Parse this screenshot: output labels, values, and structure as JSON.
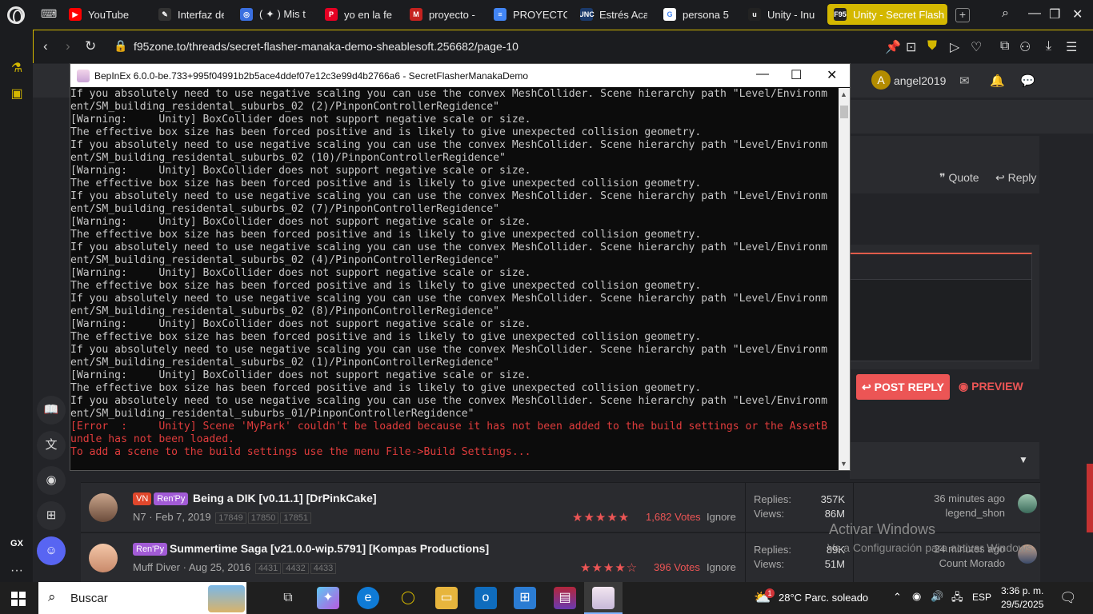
{
  "browser": {
    "tabs": [
      {
        "label": "YouTube",
        "color": "#ff0000",
        "glyph": "▶"
      },
      {
        "label": "Interfaz de",
        "color": "#333333",
        "glyph": "✎"
      },
      {
        "label": "( ✦ ) Mis t",
        "color": "#3a6fe0",
        "glyph": "◎"
      },
      {
        "label": "yo en la fe",
        "color": "#e60023",
        "glyph": "P"
      },
      {
        "label": "proyecto -",
        "color": "#c5221f",
        "glyph": "M"
      },
      {
        "label": "PROYECTO",
        "color": "#4285f4",
        "glyph": "≡"
      },
      {
        "label": "Estrés Aca",
        "color": "#1b3a6b",
        "glyph": "UNC"
      },
      {
        "label": "persona 5",
        "color": "#ffffff",
        "glyph": "G"
      },
      {
        "label": "Unity - Inu",
        "color": "#222222",
        "glyph": "u"
      },
      {
        "label": "Unity - Secret Flash",
        "color": "#222222",
        "glyph": "F95"
      }
    ],
    "tab_add": "+",
    "url": "f95zone.to/threads/secret-flasher-manaka-demo-sheablesoft.256682/page-10"
  },
  "forum": {
    "username": "angel2019",
    "avatar_letter": "A",
    "quote_label": "Quote",
    "reply_label": "Reply",
    "post_reply_label": "POST REPLY",
    "preview_label": "PREVIEW",
    "threads": [
      {
        "badges": [
          {
            "text": "VN",
            "color": "#e0472c"
          },
          {
            "text": "Ren'Py",
            "color": "#a25bd6"
          }
        ],
        "title": "Being a DIK [v0.11.1] [DrPinkCake]",
        "author_date": "N7 · Feb 7, 2019",
        "pages": [
          "17849",
          "17850",
          "17851"
        ],
        "stars": "★★★★★",
        "votes": "1,682 Votes",
        "ignore": "Ignore",
        "replies_label": "Replies:",
        "replies": "357K",
        "views_label": "Views:",
        "views": "86M",
        "last_time": "36 minutes ago",
        "last_user": "legend_shon"
      },
      {
        "badges": [
          {
            "text": "Ren'Py",
            "color": "#a25bd6"
          }
        ],
        "title": "Summertime Saga [v21.0.0-wip.5791] [Kompas Productions]",
        "author_date": "Muff Diver · Aug 25, 2016",
        "pages": [
          "4431",
          "4432",
          "4433"
        ],
        "stars": "★★★★☆",
        "votes": "396 Votes",
        "ignore": "Ignore",
        "replies_label": "Replies:",
        "replies": "89K",
        "views_label": "Views:",
        "views": "51M",
        "last_time": "24 minutes ago",
        "last_user": "Count Morado"
      }
    ],
    "activate_title": "Activar Windows",
    "activate_sub": "Ve a Configuración para activar Windows."
  },
  "console": {
    "title": "BepInEx 6.0.0-be.733+995f04991b2b5ace4ddef07e12c3e99d4b2766a6 - SecretFlasherManakaDemo",
    "lines": [
      {
        "t": "If you absolutely need to use negative scaling you can use the convex MeshCollider. Scene hierarchy path \"Level/Environm",
        "err": false
      },
      {
        "t": "ent/SM_building_residental_suburbs_02 (2)/PinponControllerRegidence\"",
        "err": false
      },
      {
        "t": "[Warning:     Unity] BoxCollider does not support negative scale or size.",
        "err": false
      },
      {
        "t": "The effective box size has been forced positive and is likely to give unexpected collision geometry.",
        "err": false
      },
      {
        "t": "If you absolutely need to use negative scaling you can use the convex MeshCollider. Scene hierarchy path \"Level/Environm",
        "err": false
      },
      {
        "t": "ent/SM_building_residental_suburbs_02 (10)/PinponControllerRegidence\"",
        "err": false
      },
      {
        "t": "[Warning:     Unity] BoxCollider does not support negative scale or size.",
        "err": false
      },
      {
        "t": "The effective box size has been forced positive and is likely to give unexpected collision geometry.",
        "err": false
      },
      {
        "t": "If you absolutely need to use negative scaling you can use the convex MeshCollider. Scene hierarchy path \"Level/Environm",
        "err": false
      },
      {
        "t": "ent/SM_building_residental_suburbs_02 (7)/PinponControllerRegidence\"",
        "err": false
      },
      {
        "t": "[Warning:     Unity] BoxCollider does not support negative scale or size.",
        "err": false
      },
      {
        "t": "The effective box size has been forced positive and is likely to give unexpected collision geometry.",
        "err": false
      },
      {
        "t": "If you absolutely need to use negative scaling you can use the convex MeshCollider. Scene hierarchy path \"Level/Environm",
        "err": false
      },
      {
        "t": "ent/SM_building_residental_suburbs_02 (4)/PinponControllerRegidence\"",
        "err": false
      },
      {
        "t": "[Warning:     Unity] BoxCollider does not support negative scale or size.",
        "err": false
      },
      {
        "t": "The effective box size has been forced positive and is likely to give unexpected collision geometry.",
        "err": false
      },
      {
        "t": "If you absolutely need to use negative scaling you can use the convex MeshCollider. Scene hierarchy path \"Level/Environm",
        "err": false
      },
      {
        "t": "ent/SM_building_residental_suburbs_02 (8)/PinponControllerRegidence\"",
        "err": false
      },
      {
        "t": "[Warning:     Unity] BoxCollider does not support negative scale or size.",
        "err": false
      },
      {
        "t": "The effective box size has been forced positive and is likely to give unexpected collision geometry.",
        "err": false
      },
      {
        "t": "If you absolutely need to use negative scaling you can use the convex MeshCollider. Scene hierarchy path \"Level/Environm",
        "err": false
      },
      {
        "t": "ent/SM_building_residental_suburbs_02 (1)/PinponControllerRegidence\"",
        "err": false
      },
      {
        "t": "[Warning:     Unity] BoxCollider does not support negative scale or size.",
        "err": false
      },
      {
        "t": "The effective box size has been forced positive and is likely to give unexpected collision geometry.",
        "err": false
      },
      {
        "t": "If you absolutely need to use negative scaling you can use the convex MeshCollider. Scene hierarchy path \"Level/Environm",
        "err": false
      },
      {
        "t": "ent/SM_building_residental_suburbs_01/PinponControllerRegidence\"",
        "err": false
      },
      {
        "t": "[Error  :     Unity] Scene 'MyPark' couldn't be loaded because it has not been added to the build settings or the AssetB",
        "err": true
      },
      {
        "t": "undle has not been loaded.",
        "err": true
      },
      {
        "t": "To add a scene to the build settings use the menu File->Build Settings...",
        "err": true
      }
    ]
  },
  "taskbar": {
    "search_label": "Buscar",
    "weather": "28°C  Parc. soleado",
    "weather_alert": "1",
    "lang": "ESP",
    "time": "3:36 p. m.",
    "date": "29/5/2025"
  },
  "sidebar": {
    "gx_label": "GX",
    "more_label": "···"
  }
}
